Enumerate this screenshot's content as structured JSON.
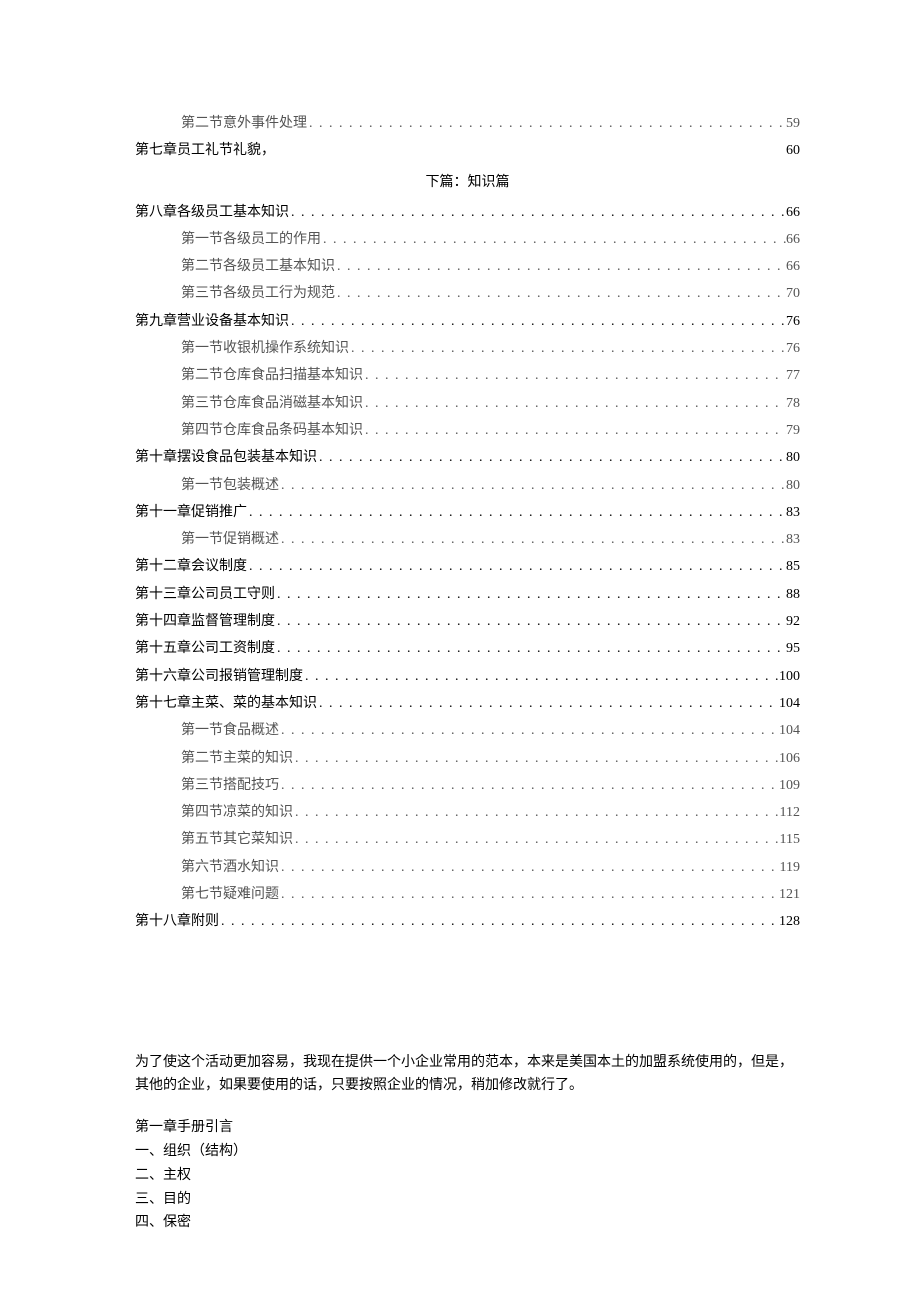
{
  "toc": {
    "before_heading": [
      {
        "level": "sub",
        "label": "第二节意外事件处理",
        "dots": true,
        "page": "59"
      },
      {
        "level": "main",
        "label": "第七章员工礼节礼貌，",
        "dots": false,
        "page": "60"
      }
    ],
    "section_heading": "下篇：知识篇",
    "after_heading": [
      {
        "level": "main",
        "label": "第八章各级员工基本知识",
        "dots": true,
        "page": "66"
      },
      {
        "level": "sub",
        "label": "第一节各级员工的作用",
        "dots": true,
        "page": "66"
      },
      {
        "level": "sub",
        "label": "第二节各级员工基本知识",
        "dots": true,
        "page": "66"
      },
      {
        "level": "sub",
        "label": "第三节各级员工行为规范",
        "dots": true,
        "page": "70"
      },
      {
        "level": "main",
        "label": "第九章营业设备基本知识",
        "dots": true,
        "page": "76"
      },
      {
        "level": "sub",
        "label": "第一节收银机操作系统知识",
        "dots": true,
        "page": "76"
      },
      {
        "level": "sub",
        "label": "第二节仓库食品扫描基本知识",
        "dots": true,
        "page": "77"
      },
      {
        "level": "sub",
        "label": "第三节仓库食品消磁基本知识",
        "dots": true,
        "page": "78"
      },
      {
        "level": "sub",
        "label": "第四节仓库食品条码基本知识",
        "dots": true,
        "page": "79"
      },
      {
        "level": "main",
        "label": "第十章摆设食品包装基本知识",
        "dots": true,
        "page": "80"
      },
      {
        "level": "sub",
        "label": "第一节包装概述",
        "dots": true,
        "page": "80"
      },
      {
        "level": "main",
        "label": "第十一章促销推广",
        "dots": true,
        "page": "83"
      },
      {
        "level": "sub",
        "label": "第一节促销概述",
        "dots": true,
        "page": "83"
      },
      {
        "level": "main",
        "label": "第十二章会议制度",
        "dots": true,
        "page": "85"
      },
      {
        "level": "main",
        "label": "第十三章公司员工守则",
        "dots": true,
        "page": "88"
      },
      {
        "level": "main",
        "label": "第十四章监督管理制度",
        "dots": true,
        "page": "92"
      },
      {
        "level": "main",
        "label": "第十五章公司工资制度",
        "dots": true,
        "page": "95"
      },
      {
        "level": "main",
        "label": "第十六章公司报销管理制度",
        "dots": true,
        "page": "100"
      },
      {
        "level": "main",
        "label": "第十七章主菜、菜的基本知识",
        "dots": true,
        "page": "104"
      },
      {
        "level": "sub",
        "label": "第一节食品概述",
        "dots": true,
        "page": "104"
      },
      {
        "level": "sub",
        "label": "第二节主菜的知识",
        "dots": true,
        "page": "106"
      },
      {
        "level": "sub",
        "label": "第三节搭配技巧",
        "dots": true,
        "page": "109"
      },
      {
        "level": "sub",
        "label": "第四节凉菜的知识",
        "dots": true,
        "page": "112"
      },
      {
        "level": "sub",
        "label": "第五节其它菜知识",
        "dots": true,
        "page": "115"
      },
      {
        "level": "sub",
        "label": "第六节酒水知识",
        "dots": true,
        "page": "119"
      },
      {
        "level": "sub",
        "label": "第七节疑难问题",
        "dots": true,
        "page": "121"
      },
      {
        "level": "main",
        "label": "第十八章附则",
        "dots": true,
        "page": "128"
      }
    ]
  },
  "body": {
    "paragraph": "为了使这个活动更加容易，我现在提供一个小企业常用的范本，本来是美国本土的加盟系统使用的，但是，其他的企业，如果要使用的话，只要按照企业的情况，稍加修改就行了。",
    "list": [
      "第一章手册引言",
      "一、组织（结构）",
      "二、主权",
      "三、目的",
      "四、保密"
    ]
  }
}
